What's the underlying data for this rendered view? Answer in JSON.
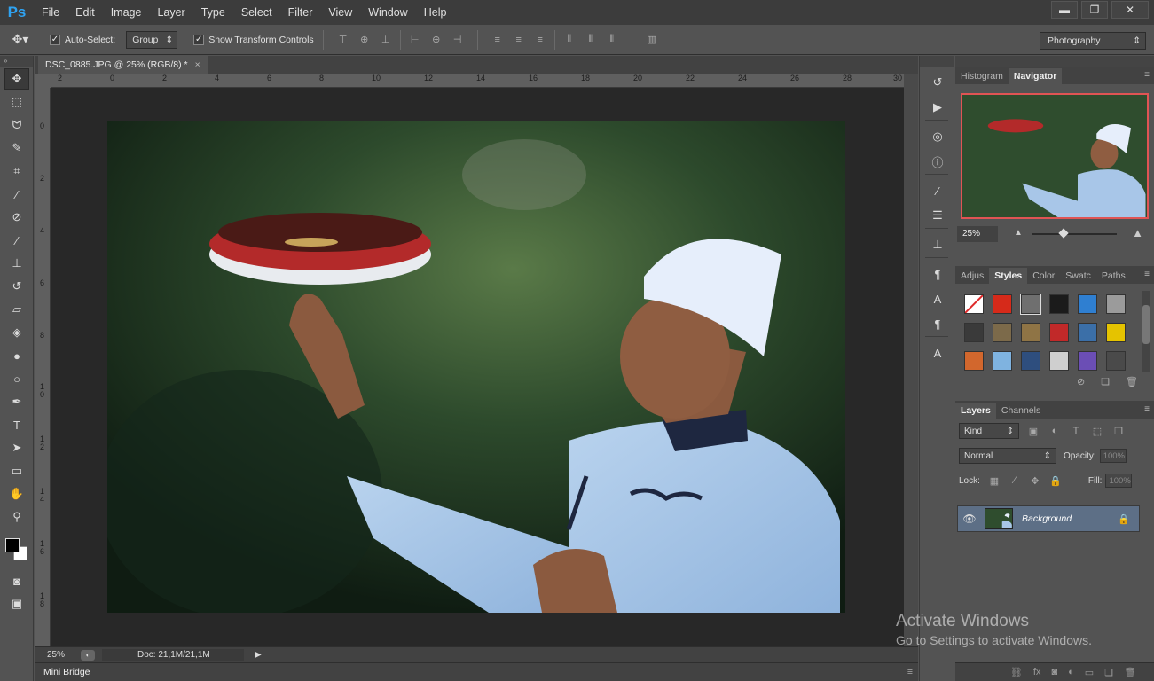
{
  "app": {
    "logo": "Ps"
  },
  "menu": [
    "File",
    "Edit",
    "Image",
    "Layer",
    "Type",
    "Select",
    "Filter",
    "View",
    "Window",
    "Help"
  ],
  "window_controls": {
    "minimize": "▬",
    "restore": "❐",
    "close": "✕"
  },
  "options": {
    "auto_select_label": "Auto-Select:",
    "auto_select_value": "Group",
    "show_transform_label": "Show Transform Controls",
    "workspace": "Photography"
  },
  "document": {
    "tab_title": "DSC_0885.JPG @ 25% (RGB/8) *",
    "close": "×",
    "ruler_h": [
      "2",
      "0",
      "2",
      "4",
      "6",
      "8",
      "10",
      "12",
      "14",
      "16",
      "18",
      "20",
      "22",
      "24",
      "26",
      "28",
      "30"
    ],
    "ruler_v": [
      "0",
      "2",
      "4",
      "6",
      "8",
      "1\n0",
      "1\n2",
      "1\n4",
      "1\n6",
      "1\n8"
    ]
  },
  "status": {
    "zoom": "25%",
    "doc": "Doc: 21,1M/21,1M",
    "minibridge": "Mini Bridge"
  },
  "navigator": {
    "tabs": [
      "Histogram",
      "Navigator"
    ],
    "zoom": "25%",
    "zoom_level": 0.25
  },
  "styles_panel": {
    "tabs": [
      "Adjus",
      "Styles",
      "Color",
      "Swatc",
      "Paths"
    ],
    "swatches": [
      "#ffffff",
      "#d62a1a",
      "#6f6f6f",
      "#1b1b1b",
      "#2f7fd1",
      "#9b9b9b",
      "#3a3a3a",
      "#7c6a4a",
      "#8f7445",
      "#c12929",
      "#3b6fa8",
      "#e5c300",
      "#d2672d",
      "#7fb3e0",
      "#2e4e7e",
      "#cfcfcf",
      "#6b4eb5",
      "#4a4a4a"
    ]
  },
  "layers": {
    "tabs": [
      "Layers",
      "Channels"
    ],
    "kind": "Kind",
    "blend": "Normal",
    "opacity_label": "Opacity:",
    "opacity": "100%",
    "lock_label": "Lock:",
    "fill_label": "Fill:",
    "fill": "100%",
    "layer_name": "Background"
  },
  "watermark": {
    "line1": "Activate Windows",
    "line2": "Go to Settings to activate Windows."
  }
}
